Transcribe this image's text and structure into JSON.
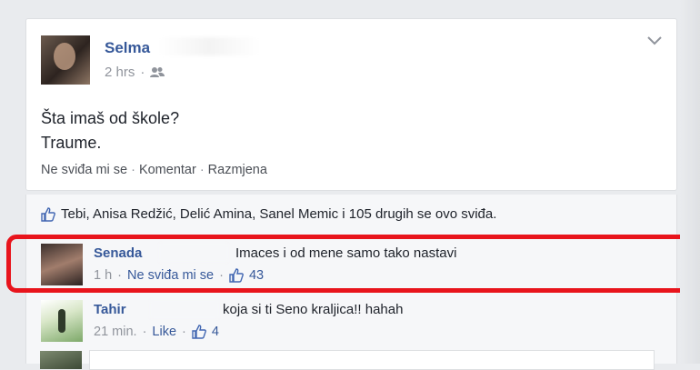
{
  "post": {
    "author": "Selma",
    "time": "2 hrs",
    "audience_icon": "friends-icon",
    "line1": "Šta imaš od škole?",
    "line2": "Traume.",
    "actions": {
      "like": "Ne sviđa mi se",
      "sep": "·",
      "comment": "Komentar",
      "share": "Razmjena"
    },
    "menu_icon": "chevron-down-icon"
  },
  "likes": {
    "text": "Tebi, Anisa Redžić, Delić Amina, Sanel Memic i 105 drugih se ovo sviđa."
  },
  "comments": [
    {
      "author": "Senada",
      "text": "Imaces i od mene samo tako nastavi",
      "time": "1 h",
      "like_label": "Ne sviđa mi se",
      "likes": "43"
    },
    {
      "author": "Tahir",
      "text": "koja si ti Seno kraljica!! hahah",
      "time": "21 min.",
      "like_label": "Like",
      "likes": "4"
    }
  ],
  "colors": {
    "link": "#365899",
    "highlight": "#e8141c",
    "background": "#e9ebee"
  }
}
